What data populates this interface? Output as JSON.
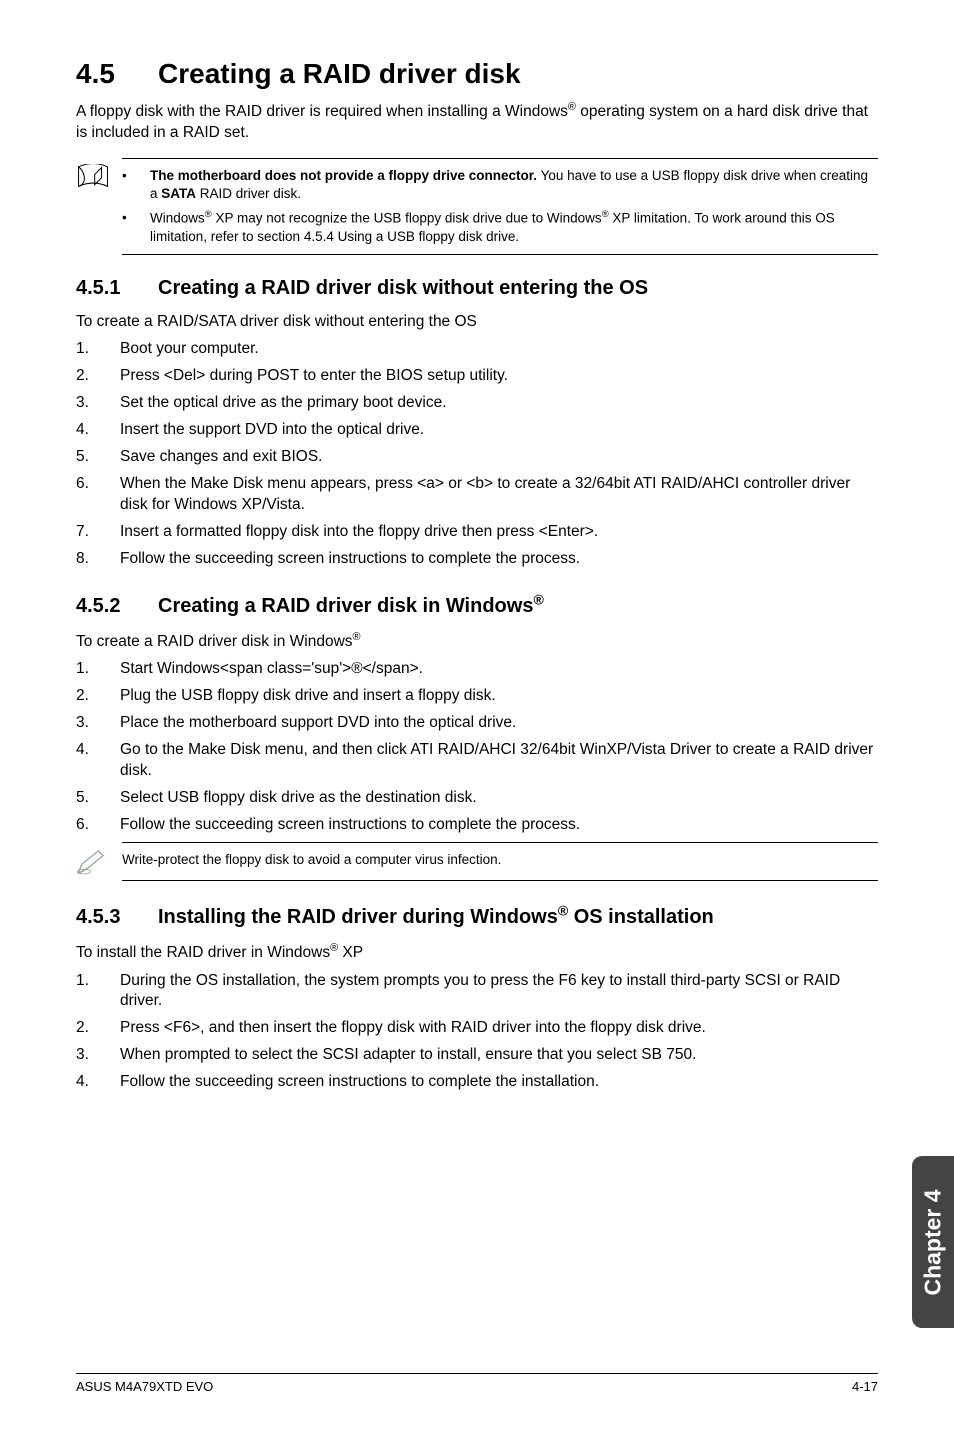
{
  "section": {
    "heading_number": "4.5",
    "heading_text": "Creating a RAID driver disk",
    "intro_html": "A floppy disk with the RAID driver is required when installing a Windows<span class='sup'>®</span> operating system on a hard disk drive that is included in a RAID set."
  },
  "note1": {
    "items": [
      "<b>The motherboard does not provide a floppy drive connector.</b> You have to use a USB floppy disk drive when creating a <b>SATA</b> RAID driver disk.",
      "Windows<span class='sup'>®</span> XP may not recognize the USB floppy disk drive due to Windows<span class='sup'>®</span> XP limitation. To work around this OS limitation, refer to section 4.5.4 Using a USB floppy disk drive."
    ]
  },
  "s451": {
    "num": "4.5.1",
    "title": "Creating a RAID driver disk without entering the OS",
    "lead": "To create a RAID/SATA driver disk without entering the OS",
    "steps": [
      "Boot your computer.",
      "Press <Del> during POST to enter the BIOS setup utility.",
      "Set the optical drive as the primary boot device.",
      "Insert the support DVD into the optical drive.",
      "Save changes and exit BIOS.",
      "When the Make Disk menu appears, press <a> or <b> to create a 32/64bit ATI RAID/AHCI controller driver disk for Windows XP/Vista.",
      "Insert a formatted floppy disk into the floppy drive then press <Enter>.",
      "Follow the succeeding screen instructions to complete the process."
    ]
  },
  "s452": {
    "num": "4.5.2",
    "title_html": "Creating a RAID driver disk in Windows<span class='sup'>®</span>",
    "lead_html": "To create a RAID driver disk in Windows<span class='sup'>®</span>",
    "steps": [
      "Start Windows<span class='sup'>®</span>.",
      "Plug the USB floppy disk drive and insert a floppy disk.",
      "Place the motherboard support DVD into the optical drive.",
      "Go to the Make Disk menu, and then click ATI RAID/AHCI 32/64bit WinXP/Vista Driver to create a RAID driver disk.",
      "Select USB floppy disk drive as the destination disk.",
      "Follow the succeeding screen instructions to complete the process."
    ]
  },
  "note2": {
    "text": "Write-protect the floppy disk to avoid a computer virus infection."
  },
  "s453": {
    "num": "4.5.3",
    "title_html": "Installing the RAID driver during Windows<span class='sup'>®</span> OS installation",
    "lead_html": "To install the RAID driver in Windows<span class='sup'>®</span> XP",
    "steps": [
      "During the OS installation, the system prompts you to press the F6 key to install third-party SCSI or RAID driver.",
      "Press <F6>, and then insert the floppy disk with RAID driver into the floppy disk drive.",
      "When prompted to select the SCSI adapter to install, ensure that you select SB 750.",
      "Follow the succeeding screen instructions to complete the installation."
    ]
  },
  "sidebar": {
    "label": "Chapter 4"
  },
  "footer": {
    "left": "ASUS M4A79XTD EVO",
    "right": "4-17"
  }
}
